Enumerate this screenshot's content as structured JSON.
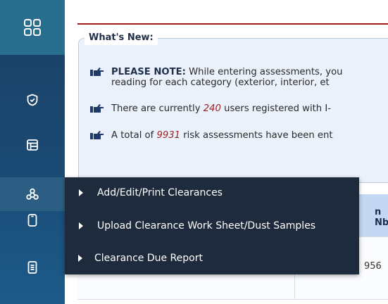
{
  "sidebar": {
    "items": [
      {
        "icon": "grid-icon"
      },
      {
        "icon": "shield-check-icon"
      },
      {
        "icon": "table-icon"
      },
      {
        "icon": "network-icon"
      },
      {
        "icon": "tablet-icon"
      },
      {
        "icon": "document-icon"
      }
    ]
  },
  "whats_new": {
    "legend": "What's New:",
    "notes": [
      {
        "bold": "PLEASE NOTE:",
        "line1": " While entering assessments, you",
        "line2": "reading for each category (exterior, interior, et"
      },
      {
        "pre": "There are currently ",
        "value": "240",
        "post": " users registered with I-"
      },
      {
        "pre": "A total of ",
        "value": "9931",
        "post": " risk assessments have been ent"
      }
    ]
  },
  "table": {
    "header_fragment": "n Nb",
    "row_fragment": "956"
  },
  "flyout_menu": {
    "items": [
      {
        "label": "Add/Edit/Print Clearances"
      },
      {
        "label": "Upload Clearance Work Sheet/Dust Samples"
      },
      {
        "label": "Clearance Due Report"
      }
    ]
  },
  "colors": {
    "sidebar": "#1c3f63",
    "sidebar_top": "#2a6e8f",
    "flyout": "#1e2b3c",
    "highlight": "#9c1f1f",
    "panel_bg": "#eaf1fb"
  }
}
